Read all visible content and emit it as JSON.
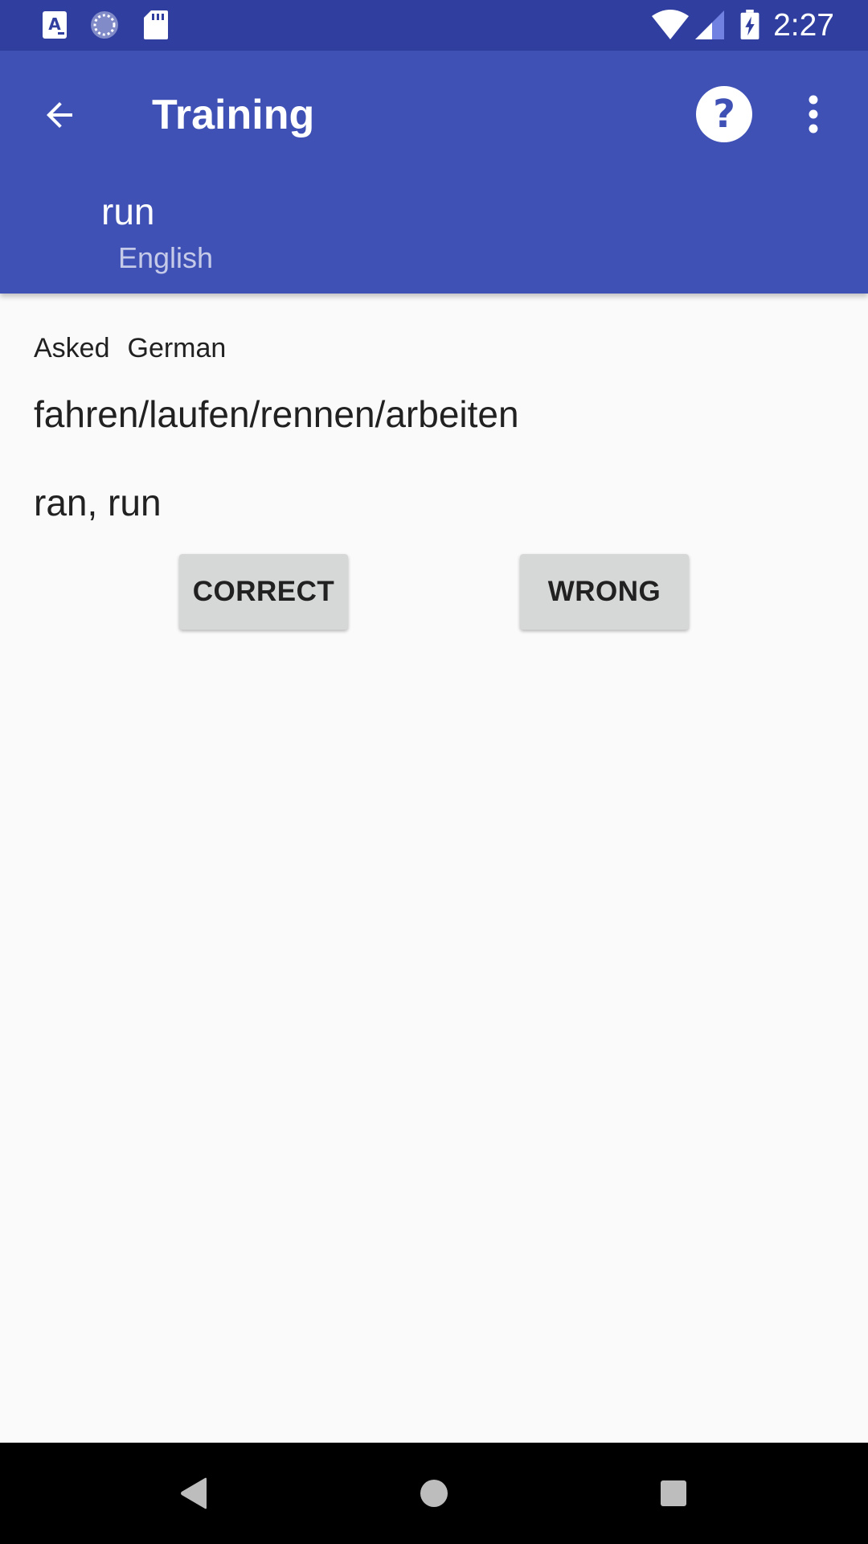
{
  "status_bar": {
    "time": "2:27",
    "icons": [
      "text-notification-icon",
      "sync-icon",
      "sd-card-icon",
      "wifi-icon",
      "signal-icon",
      "battery-charging-icon"
    ]
  },
  "app_bar": {
    "title": "Training",
    "back_icon": "arrow-back-icon",
    "help_icon": "help-icon",
    "more_icon": "more-vert-icon",
    "word": "run",
    "word_language": "English"
  },
  "content": {
    "asked_label": "Asked",
    "asked_language": "German",
    "question": "fahren/laufen/rennen/arbeiten",
    "answer": "ran, run",
    "correct_label": "CORRECT",
    "wrong_label": "WRONG"
  },
  "colors": {
    "status_bar": "#303f9f",
    "app_bar": "#3f51b5",
    "subtitle": "#c5cae9",
    "background": "#fafafa",
    "button": "#d6d7d7"
  },
  "nav_bar": {
    "icons": [
      "nav-back-icon",
      "nav-home-icon",
      "nav-recent-icon"
    ]
  }
}
